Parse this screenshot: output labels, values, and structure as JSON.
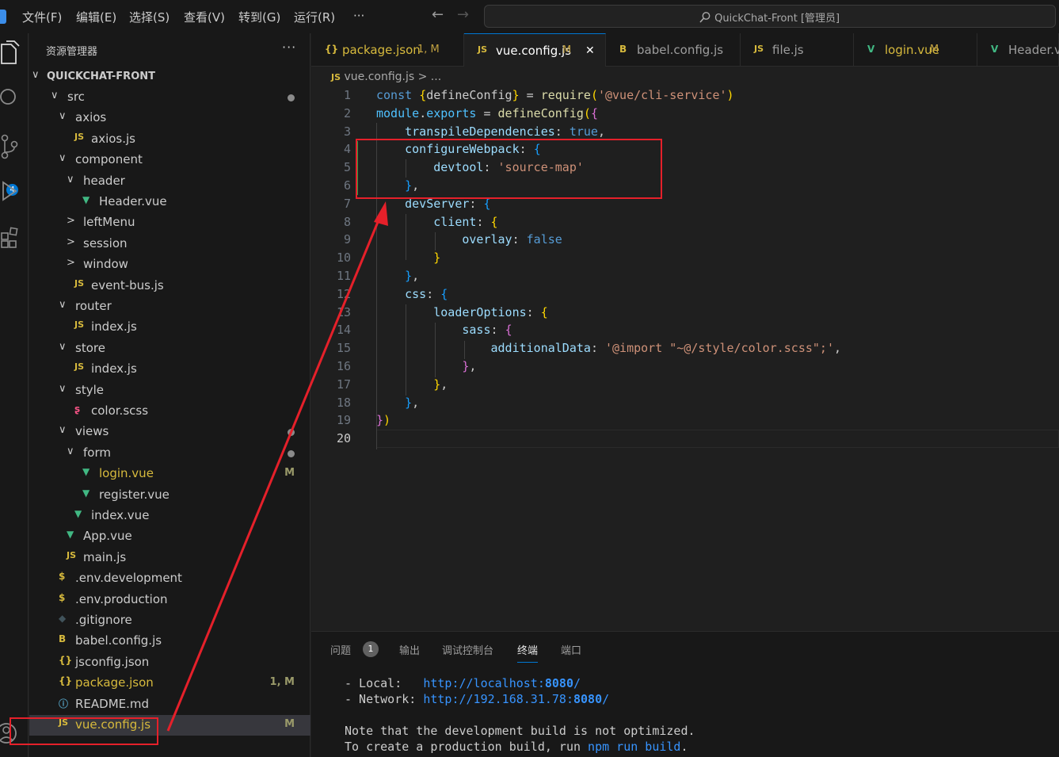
{
  "titlebar": {
    "menu": [
      "文件(F)",
      "编辑(E)",
      "选择(S)",
      "查看(V)",
      "转到(G)",
      "运行(R)",
      "···"
    ],
    "command_center": "QuickChat-Front [管理员]",
    "back_glyph": "←",
    "forward_glyph": "→",
    "search_glyph": "⌕"
  },
  "activitybar": {
    "icons": [
      "explorer-icon",
      "search-icon",
      "source-control-icon",
      "run-debug-icon",
      "extensions-icon",
      "account-icon"
    ],
    "scm_badge": "4"
  },
  "sidebar": {
    "title": "资源管理器",
    "more": "···",
    "project": "QUICKCHAT-FRONT",
    "tree": [
      {
        "label": "src",
        "type": "folder",
        "open": true,
        "depth": 0,
        "dot": true
      },
      {
        "label": "axios",
        "type": "folder",
        "open": true,
        "depth": 1
      },
      {
        "label": "axios.js",
        "type": "js",
        "depth": 2
      },
      {
        "label": "component",
        "type": "folder",
        "open": true,
        "depth": 1
      },
      {
        "label": "header",
        "type": "folder",
        "open": true,
        "depth": 2
      },
      {
        "label": "Header.vue",
        "type": "vue",
        "depth": 3
      },
      {
        "label": "leftMenu",
        "type": "folder",
        "open": false,
        "depth": 2
      },
      {
        "label": "session",
        "type": "folder",
        "open": false,
        "depth": 2
      },
      {
        "label": "window",
        "type": "folder",
        "open": false,
        "depth": 2
      },
      {
        "label": "event-bus.js",
        "type": "js",
        "depth": 2
      },
      {
        "label": "router",
        "type": "folder",
        "open": true,
        "depth": 1
      },
      {
        "label": "index.js",
        "type": "js",
        "depth": 2
      },
      {
        "label": "store",
        "type": "folder",
        "open": true,
        "depth": 1
      },
      {
        "label": "index.js",
        "type": "js",
        "depth": 2
      },
      {
        "label": "style",
        "type": "folder",
        "open": true,
        "depth": 1
      },
      {
        "label": "color.scss",
        "type": "sass",
        "depth": 2
      },
      {
        "label": "views",
        "type": "folder",
        "open": true,
        "depth": 1,
        "dot": true
      },
      {
        "label": "form",
        "type": "folder",
        "open": true,
        "depth": 2,
        "dot": true
      },
      {
        "label": "login.vue",
        "type": "vue",
        "depth": 3,
        "status": "M",
        "modified": true
      },
      {
        "label": "register.vue",
        "type": "vue",
        "depth": 3
      },
      {
        "label": "index.vue",
        "type": "vue",
        "depth": 2
      },
      {
        "label": "App.vue",
        "type": "vue",
        "depth": 1
      },
      {
        "label": "main.js",
        "type": "js",
        "depth": 1
      },
      {
        "label": ".env.development",
        "type": "env",
        "depth": 0
      },
      {
        "label": ".env.production",
        "type": "env",
        "depth": 0
      },
      {
        "label": ".gitignore",
        "type": "git",
        "depth": 0
      },
      {
        "label": "babel.config.js",
        "type": "babel",
        "depth": 0
      },
      {
        "label": "jsconfig.json",
        "type": "json",
        "depth": 0
      },
      {
        "label": "package.json",
        "type": "json",
        "depth": 0,
        "status": "1, M",
        "modified": true
      },
      {
        "label": "README.md",
        "type": "info",
        "depth": 0
      },
      {
        "label": "vue.config.js",
        "type": "js",
        "depth": 0,
        "status": "M",
        "modified": true,
        "selected": true
      }
    ]
  },
  "tabs": [
    {
      "icon": "{}",
      "label": "package.json",
      "status": "1, M",
      "kind": "json"
    },
    {
      "icon": "JS",
      "label": "vue.config.js",
      "status": "M",
      "kind": "js",
      "active": true,
      "close": "✕"
    },
    {
      "icon": "B",
      "label": "babel.config.js",
      "status": "",
      "kind": "babel"
    },
    {
      "icon": "JS",
      "label": "file.js",
      "status": "",
      "kind": "js"
    },
    {
      "icon": "V",
      "label": "login.vue",
      "status": "M",
      "kind": "vue"
    },
    {
      "icon": "V",
      "label": "Header.vu",
      "status": "",
      "kind": "vue"
    }
  ],
  "breadcrumb": {
    "icon": "JS",
    "text": "vue.config.js > ..."
  },
  "editor": {
    "line_numbers": [
      "1",
      "2",
      "3",
      "4",
      "5",
      "6",
      "7",
      "8",
      "9",
      "10",
      "11",
      "12",
      "13",
      "14",
      "15",
      "16",
      "17",
      "18",
      "19",
      "20"
    ],
    "current_line": "20",
    "lines": [
      [
        [
          "kw",
          "const "
        ],
        [
          "b1",
          "{"
        ],
        [
          "plain",
          "defineConfig"
        ],
        [
          "b1",
          "}"
        ],
        [
          "plain",
          " = "
        ],
        [
          "fn",
          "require"
        ],
        [
          "b1",
          "("
        ],
        [
          "st",
          "'@vue/cli-service'"
        ],
        [
          "b1",
          ")"
        ]
      ],
      [
        [
          "var",
          "module"
        ],
        [
          "plain",
          "."
        ],
        [
          "var",
          "exports"
        ],
        [
          "plain",
          " = "
        ],
        [
          "fn",
          "defineConfig"
        ],
        [
          "b1",
          "("
        ],
        [
          "b2",
          "{"
        ]
      ],
      [
        [
          "plain",
          "    "
        ],
        [
          "pr",
          "transpileDependencies"
        ],
        [
          "plain",
          ": "
        ],
        [
          "kw",
          "true"
        ],
        [
          "plain",
          ","
        ]
      ],
      [
        [
          "plain",
          "    "
        ],
        [
          "pr",
          "configureWebpack"
        ],
        [
          "plain",
          ": "
        ],
        [
          "b3",
          "{"
        ]
      ],
      [
        [
          "plain",
          "        "
        ],
        [
          "pr",
          "devtool"
        ],
        [
          "plain",
          ": "
        ],
        [
          "st",
          "'source-map'"
        ]
      ],
      [
        [
          "plain",
          "    "
        ],
        [
          "b3",
          "}"
        ],
        [
          "plain",
          ","
        ]
      ],
      [
        [
          "plain",
          "    "
        ],
        [
          "pr",
          "devServer"
        ],
        [
          "plain",
          ": "
        ],
        [
          "b3",
          "{"
        ]
      ],
      [
        [
          "plain",
          "        "
        ],
        [
          "pr",
          "client"
        ],
        [
          "plain",
          ": "
        ],
        [
          "b1",
          "{"
        ]
      ],
      [
        [
          "plain",
          "            "
        ],
        [
          "pr",
          "overlay"
        ],
        [
          "plain",
          ": "
        ],
        [
          "kw",
          "false"
        ]
      ],
      [
        [
          "plain",
          "        "
        ],
        [
          "b1",
          "}"
        ]
      ],
      [
        [
          "plain",
          "    "
        ],
        [
          "b3",
          "}"
        ],
        [
          "plain",
          ","
        ]
      ],
      [
        [
          "plain",
          "    "
        ],
        [
          "pr",
          "css"
        ],
        [
          "plain",
          ": "
        ],
        [
          "b3",
          "{"
        ]
      ],
      [
        [
          "plain",
          "        "
        ],
        [
          "pr",
          "loaderOptions"
        ],
        [
          "plain",
          ": "
        ],
        [
          "b1",
          "{"
        ]
      ],
      [
        [
          "plain",
          "            "
        ],
        [
          "pr",
          "sass"
        ],
        [
          "plain",
          ": "
        ],
        [
          "b2",
          "{"
        ]
      ],
      [
        [
          "plain",
          "                "
        ],
        [
          "pr",
          "additionalData"
        ],
        [
          "plain",
          ": "
        ],
        [
          "st",
          "'@import \"~@/style/color.scss\";'"
        ],
        [
          "plain",
          ","
        ]
      ],
      [
        [
          "plain",
          "            "
        ],
        [
          "b2",
          "}"
        ],
        [
          "plain",
          ","
        ]
      ],
      [
        [
          "plain",
          "        "
        ],
        [
          "b1",
          "}"
        ],
        [
          "plain",
          ","
        ]
      ],
      [
        [
          "plain",
          "    "
        ],
        [
          "b3",
          "}"
        ],
        [
          "plain",
          ","
        ]
      ],
      [
        [
          "b2",
          "}"
        ],
        [
          "b1",
          ")"
        ]
      ],
      [
        [
          "plain",
          ""
        ]
      ]
    ]
  },
  "panel": {
    "tabs": [
      "问题",
      "输出",
      "调试控制台",
      "终端",
      "端口"
    ],
    "active_tab": "终端",
    "problems_count": "1",
    "terminal": {
      "local_label": "- Local:   ",
      "local_url_prefix": "http://localhost:",
      "local_port": "8080",
      "local_url_suffix": "/",
      "network_label": "- Network: ",
      "network_url_prefix": "http://192.168.31.78:",
      "network_port": "8080",
      "network_url_suffix": "/",
      "note": "Note that the development build is not optimized.",
      "create_prefix": "To create a production build, run ",
      "create_cmd": "npm run build",
      "create_suffix": "."
    }
  },
  "annotation": {
    "color": "#e5202a"
  }
}
